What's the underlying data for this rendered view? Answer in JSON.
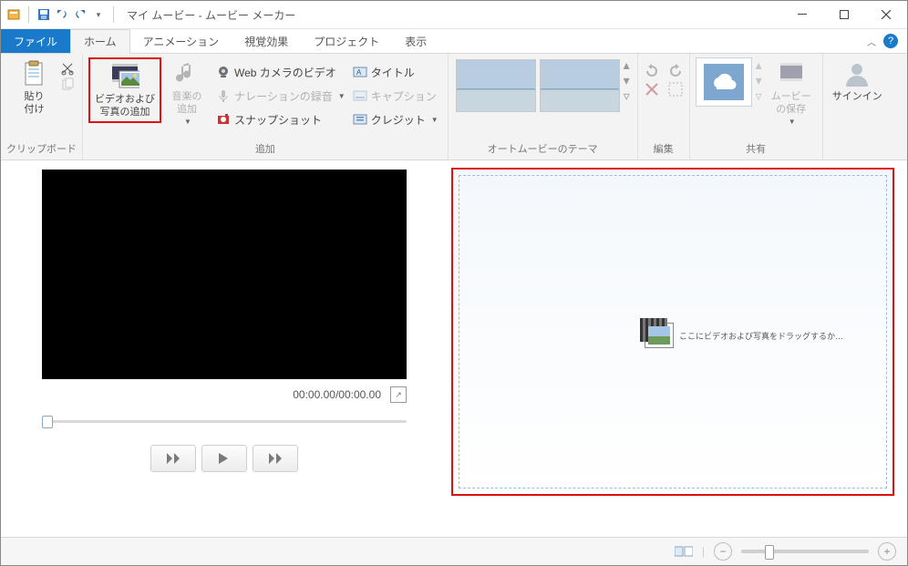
{
  "title": "マイ ムービー - ムービー メーカー",
  "tabs": {
    "file": "ファイル",
    "home": "ホーム",
    "animation": "アニメーション",
    "visual": "視覚効果",
    "project": "プロジェクト",
    "view": "表示"
  },
  "groups": {
    "clipboard": {
      "label": "クリップボード",
      "paste": "貼り\n付け"
    },
    "add": {
      "label": "追加",
      "add_media": "ビデオおよび\n写真の追加",
      "add_music": "音楽の\n追加",
      "webcam": "Web カメラのビデオ",
      "narration": "ナレーションの録音",
      "snapshot": "スナップショット",
      "title_btn": "タイトル",
      "caption": "キャプション",
      "credit": "クレジット"
    },
    "automovie": {
      "label": "オートムービーのテーマ"
    },
    "edit": {
      "label": "編集"
    },
    "share": {
      "label": "共有",
      "save_movie": "ムービー\nの保存"
    },
    "signin": {
      "label": "サインイン"
    }
  },
  "player": {
    "time": "00:00.00/00:00.00"
  },
  "storyboard": {
    "placeholder": "ここにビデオおよび写真をドラッグするか…"
  }
}
